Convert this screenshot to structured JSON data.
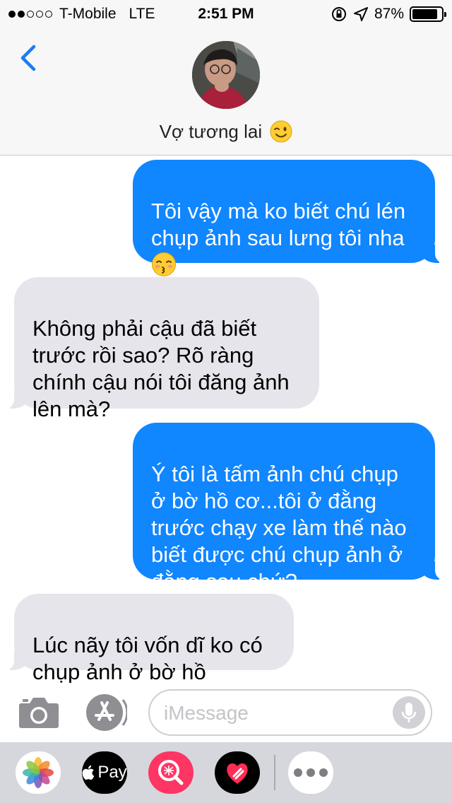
{
  "status_bar": {
    "carrier": "T-Mobile",
    "network": "LTE",
    "time": "2:51 PM",
    "battery_percent": "87%",
    "battery_level": 0.87,
    "signal_bars": 2,
    "icons": [
      "orientation-lock-icon",
      "location-arrow-icon",
      "battery-icon"
    ]
  },
  "header": {
    "back_icon": "chevron-left-icon",
    "contact_name": "Vợ tương lai",
    "contact_emoji": "winking-face-emoji"
  },
  "messages": [
    {
      "direction": "sent",
      "text": "Tôi vậy mà ko biết chú lén\nchụp ảnh sau lưng tôi nha\n",
      "emoji": "kissing-face-emoji"
    },
    {
      "direction": "received",
      "text": "Không phải cậu đã biết\ntrước rồi sao? Rõ ràng\nchính cậu nói tôi đăng ảnh\nlên mà?"
    },
    {
      "direction": "sent",
      "text": "Ý tôi là tấm ảnh chú chụp\nở bờ hồ cơ...tôi ở đằng\ntrước chạy xe làm thế nào\nbiết được chú chụp ảnh ở\nđằng sau chứ?"
    },
    {
      "direction": "received",
      "text": "Lúc nãy tôi vốn dĩ ko có\nchụp ảnh ở bờ hồ"
    }
  ],
  "input": {
    "placeholder": "iMessage",
    "camera_icon": "camera-icon",
    "appstore_icon": "app-store-icon",
    "mic_icon": "microphone-icon"
  },
  "app_drawer": {
    "apple_pay_label": "Pay",
    "apps": [
      "photos-app-icon",
      "apple-pay-icon",
      "image-search-icon",
      "digital-touch-heart-icon",
      "more-apps-icon"
    ]
  },
  "colors": {
    "sent_bubble": "#1086ff",
    "received_bubble": "#e6e5eb",
    "accent": "#1a7cf2"
  }
}
